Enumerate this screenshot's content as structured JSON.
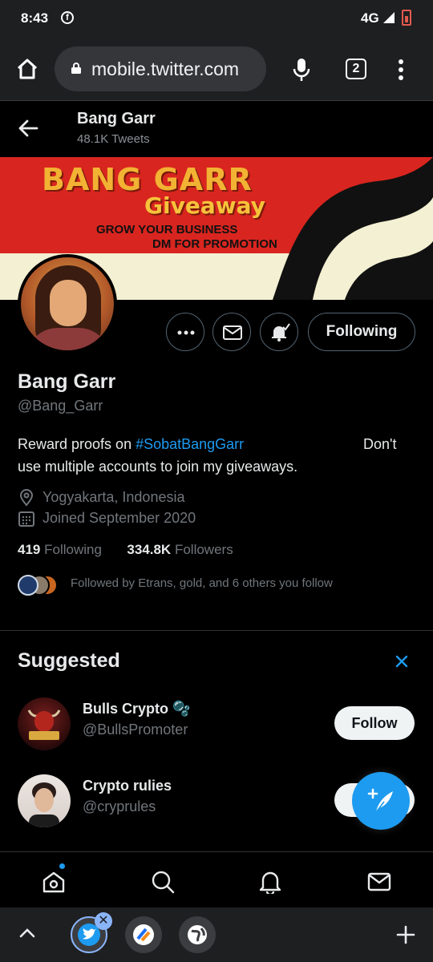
{
  "status": {
    "time": "8:43",
    "network": "4G"
  },
  "browser": {
    "url": "mobile.twitter.com",
    "tab_count": "2"
  },
  "header": {
    "name": "Bang Garr",
    "tweets": "48.1K Tweets"
  },
  "banner": {
    "brand": "BANG GARR",
    "giveaway": "Giveaway",
    "line1": "GROW YOUR BUSINESS",
    "line2": "DM FOR PROMOTION"
  },
  "profile": {
    "name": "Bang Garr",
    "handle": "@Bang_Garr",
    "follow_state_label": "Following",
    "bio_prefix": "Reward proofs on ",
    "bio_hashtag": "#SobatBangGarr",
    "bio_suffix_1": "Don't",
    "bio_suffix_2": "use multiple accounts to join my giveaways.",
    "location": "Yogyakarta, Indonesia",
    "joined": "Joined September 2020",
    "following_count": "419",
    "following_label": "Following",
    "followers_count": "334.8K",
    "followers_label": "Followers",
    "followed_by": "Followed by Etrans, gold, and 6 others you follow"
  },
  "suggested": {
    "title": "Suggested",
    "items": [
      {
        "name": "Bulls Crypto 🫧",
        "handle": "@BullsPromoter",
        "button": "Follow"
      },
      {
        "name": "Crypto rulies",
        "handle": "@cryprules",
        "button": "Follow"
      }
    ]
  },
  "colors": {
    "accent": "#1d9bf0",
    "banner_red": "#d9251f",
    "banner_cream": "#f3f0d3"
  },
  "icons": {
    "back": "arrow-left-icon",
    "more": "ellipsis-icon",
    "message": "envelope-icon",
    "notify": "bell-check-icon",
    "location": "map-pin-icon",
    "calendar": "calendar-icon",
    "compose": "feather-plus-icon",
    "nav": [
      "home-icon",
      "search-icon",
      "bell-icon",
      "mail-icon"
    ]
  }
}
